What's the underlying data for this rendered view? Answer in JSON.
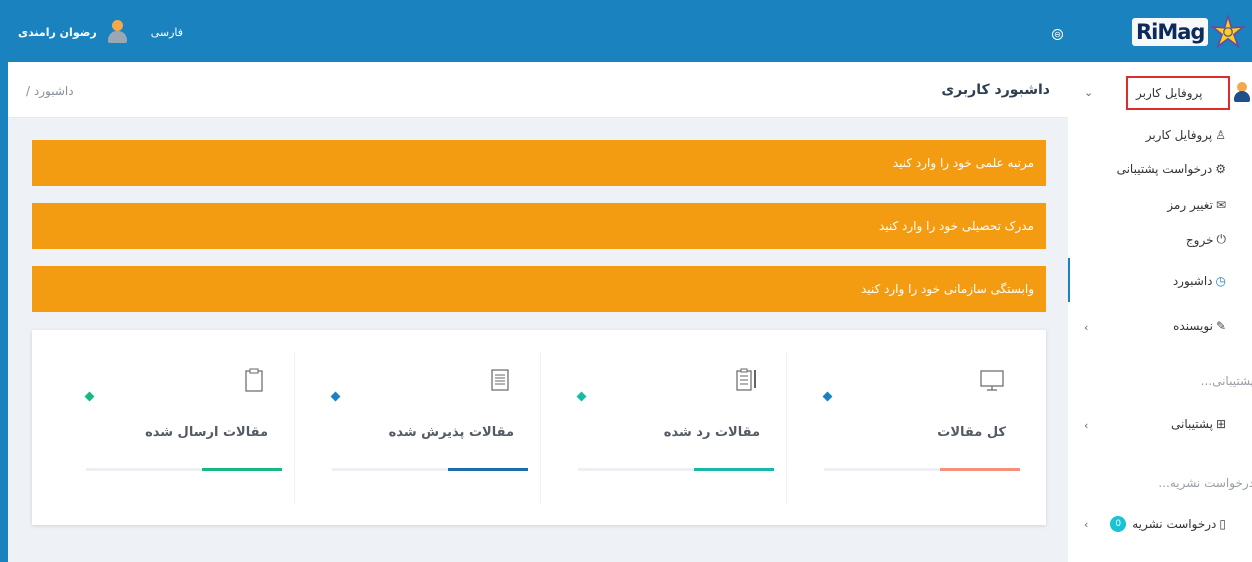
{
  "topbar": {
    "user_name": "رضوان رامندی",
    "language": "فارسی",
    "logo_text": "RiMag",
    "collapse_glyph": "⊖",
    "accent_color": "#1a82bf"
  },
  "header": {
    "title": "داشبورد کاربری",
    "breadcrumb": "داشبورد  /"
  },
  "alerts": [
    {
      "text": "مرتبه علمی خود را وارد کنید"
    },
    {
      "text": "مدرک تحصیلی خود را وارد کنید"
    },
    {
      "text": "وابستگی سازمانی خود را وارد کنید"
    }
  ],
  "alert_color": "#f39c12",
  "stats": [
    {
      "label": "کل مقالات",
      "icon": "monitor-icon",
      "dot_color": "#1a82bf",
      "bar_color": "#f4917a"
    },
    {
      "label": "مقالات رد شده",
      "icon": "document-edit-icon",
      "dot_color": "#17b8a6",
      "bar_color": "#17b8a6"
    },
    {
      "label": "مقالات پذیرش شده",
      "icon": "document-list-icon",
      "dot_color": "#1a82bf",
      "bar_color": "#1a6fab"
    },
    {
      "label": "مقالات ارسال شده",
      "icon": "clipboard-icon",
      "dot_color": "#17b883",
      "bar_color": "#17b883"
    }
  ],
  "sidebar": {
    "profile_label": "پروفایل کاربر",
    "items": [
      {
        "label": "پروفایل کاربر",
        "icon": "user-outline-icon",
        "glyph": "♙"
      },
      {
        "label": "درخواست پشتیبانی",
        "icon": "gear-icon",
        "glyph": "⚙"
      },
      {
        "label": "تغییر رمز",
        "icon": "envelope-icon",
        "glyph": "✉"
      },
      {
        "label": "خروج",
        "icon": "power-icon",
        "glyph": "⏻"
      }
    ],
    "dashboard_label": "داشبورد",
    "author_label": "نویسنده",
    "support_section": "پشتیبانی...",
    "support_label": "پشتیبانی",
    "journal_section": "درخواست نشریه...",
    "journal_label": "درخواست نشریه",
    "badge": "0"
  }
}
